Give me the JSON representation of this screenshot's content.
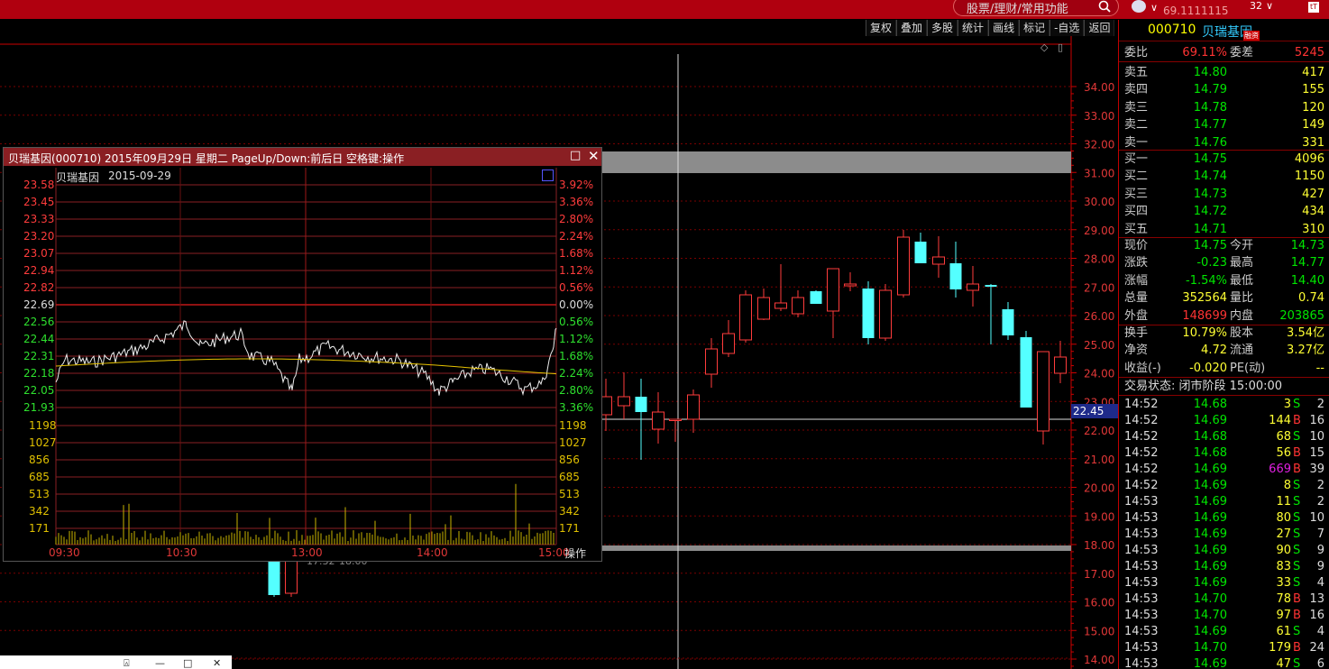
{
  "topbar": {
    "search_placeholder": "股票/理财/常用功能",
    "ticker": "69.1111115",
    "num": "32",
    "chevron": "∨",
    "app_icon": "tT"
  },
  "toolbar": [
    "复权",
    "叠加",
    "多股",
    "统计",
    "画线",
    "标记",
    "-自选",
    "返回"
  ],
  "main_chart": {
    "y_ticks": [
      "34.00",
      "33.00",
      "32.00",
      "31.00",
      "30.00",
      "29.00",
      "28.00",
      "27.00",
      "26.00",
      "25.00",
      "24.00",
      "23.00",
      "22.00",
      "21.00",
      "20.00",
      "19.00",
      "18.00",
      "17.00",
      "16.00",
      "15.00",
      "14.00"
    ],
    "cursor_price": "22.45",
    "candles_hidden_labels": [
      "17.32",
      "18.00"
    ],
    "icons": [
      "◇",
      "▯"
    ]
  },
  "stock": {
    "code": "000710",
    "name": "贝瑞基因",
    "badge": "融资",
    "webi_label": "委比",
    "webi_value": "69.11%",
    "weicha_label": "委差",
    "weicha_value": "5245",
    "asks": [
      {
        "label": "卖五",
        "price": "14.80",
        "vol": "417"
      },
      {
        "label": "卖四",
        "price": "14.79",
        "vol": "155"
      },
      {
        "label": "卖三",
        "price": "14.78",
        "vol": "120"
      },
      {
        "label": "卖二",
        "price": "14.77",
        "vol": "149"
      },
      {
        "label": "卖一",
        "price": "14.76",
        "vol": "331"
      }
    ],
    "bids": [
      {
        "label": "买一",
        "price": "14.75",
        "vol": "4096"
      },
      {
        "label": "买二",
        "price": "14.74",
        "vol": "1150"
      },
      {
        "label": "买三",
        "price": "14.73",
        "vol": "427"
      },
      {
        "label": "买四",
        "price": "14.72",
        "vol": "434"
      },
      {
        "label": "买五",
        "price": "14.71",
        "vol": "310"
      }
    ],
    "stats": [
      {
        "l1": "现价",
        "v1": "14.75",
        "c1": "c-green",
        "l2": "今开",
        "v2": "14.73",
        "c2": "c-green"
      },
      {
        "l1": "涨跌",
        "v1": "-0.23",
        "c1": "c-green",
        "l2": "最高",
        "v2": "14.77",
        "c2": "c-green"
      },
      {
        "l1": "涨幅",
        "v1": "-1.54%",
        "c1": "c-green",
        "l2": "最低",
        "v2": "14.40",
        "c2": "c-green"
      },
      {
        "l1": "总量",
        "v1": "352564",
        "c1": "c-yellow",
        "l2": "量比",
        "v2": "0.74",
        "c2": "c-yellow"
      },
      {
        "l1": "外盘",
        "v1": "148699",
        "c1": "c-red",
        "l2": "内盘",
        "v2": "203865",
        "c2": "c-green"
      }
    ],
    "stats2": [
      {
        "l1": "换手",
        "v1": "10.79%",
        "l2": "股本",
        "v2": "3.54亿"
      },
      {
        "l1": "净资",
        "v1": "4.72",
        "l2": "流通",
        "v2": "3.27亿"
      },
      {
        "l1": "收益(-)",
        "v1": "-0.020",
        "l2": "PE(动)",
        "v2": "--"
      }
    ],
    "trade_status": "交易状态: 闭市阶段 15:00:00",
    "ticks": [
      {
        "t": "14:52",
        "p": "14.68",
        "v": "3",
        "s": "S",
        "n": "2"
      },
      {
        "t": "14:52",
        "p": "14.69",
        "v": "144",
        "s": "B",
        "n": "16"
      },
      {
        "t": "14:52",
        "p": "14.68",
        "v": "68",
        "s": "S",
        "n": "10"
      },
      {
        "t": "14:52",
        "p": "14.68",
        "v": "56",
        "s": "B",
        "n": "15"
      },
      {
        "t": "14:52",
        "p": "14.69",
        "v": "669",
        "s": "B",
        "n": "39"
      },
      {
        "t": "14:52",
        "p": "14.69",
        "v": "8",
        "s": "S",
        "n": "2"
      },
      {
        "t": "14:53",
        "p": "14.69",
        "v": "11",
        "s": "S",
        "n": "2"
      },
      {
        "t": "14:53",
        "p": "14.69",
        "v": "80",
        "s": "S",
        "n": "10"
      },
      {
        "t": "14:53",
        "p": "14.69",
        "v": "27",
        "s": "S",
        "n": "7"
      },
      {
        "t": "14:53",
        "p": "14.69",
        "v": "90",
        "s": "S",
        "n": "9"
      },
      {
        "t": "14:53",
        "p": "14.69",
        "v": "83",
        "s": "S",
        "n": "9"
      },
      {
        "t": "14:53",
        "p": "14.69",
        "v": "33",
        "s": "S",
        "n": "4"
      },
      {
        "t": "14:53",
        "p": "14.70",
        "v": "78",
        "s": "B",
        "n": "13"
      },
      {
        "t": "14:53",
        "p": "14.70",
        "v": "97",
        "s": "B",
        "n": "16"
      },
      {
        "t": "14:53",
        "p": "14.69",
        "v": "61",
        "s": "S",
        "n": "4"
      },
      {
        "t": "14:53",
        "p": "14.70",
        "v": "179",
        "s": "B",
        "n": "24"
      },
      {
        "t": "14:53",
        "p": "14.69",
        "v": "47",
        "s": "S",
        "n": "6"
      }
    ]
  },
  "popup": {
    "title": "贝瑞基因(000710) 2015年09月29日 星期二 PageUp/Down:前后日 空格键:操作",
    "subtitle": "贝瑞基因",
    "date": "2015-09-29",
    "op_label": "操作",
    "max_icon": "□",
    "close_icon": "✕",
    "left_prices": [
      "23.58",
      "23.45",
      "23.33",
      "23.20",
      "23.07",
      "22.94",
      "22.82",
      "22.69",
      "22.56",
      "22.44",
      "22.31",
      "22.18",
      "22.05",
      "21.93"
    ],
    "right_pcts": [
      "3.92%",
      "3.36%",
      "2.80%",
      "2.24%",
      "1.68%",
      "1.12%",
      "0.56%",
      "0.00%",
      "0.56%",
      "1.12%",
      "1.68%",
      "2.24%",
      "2.80%",
      "3.36%"
    ],
    "vol_ticks": [
      "1198",
      "1027",
      "856",
      "685",
      "513",
      "342",
      "171"
    ],
    "time_labels": [
      "09:30",
      "10:30",
      "13:00",
      "14:00",
      "15:00"
    ]
  },
  "miniwin": {
    "icons": [
      "⍓",
      "—",
      "□",
      "✕"
    ]
  }
}
